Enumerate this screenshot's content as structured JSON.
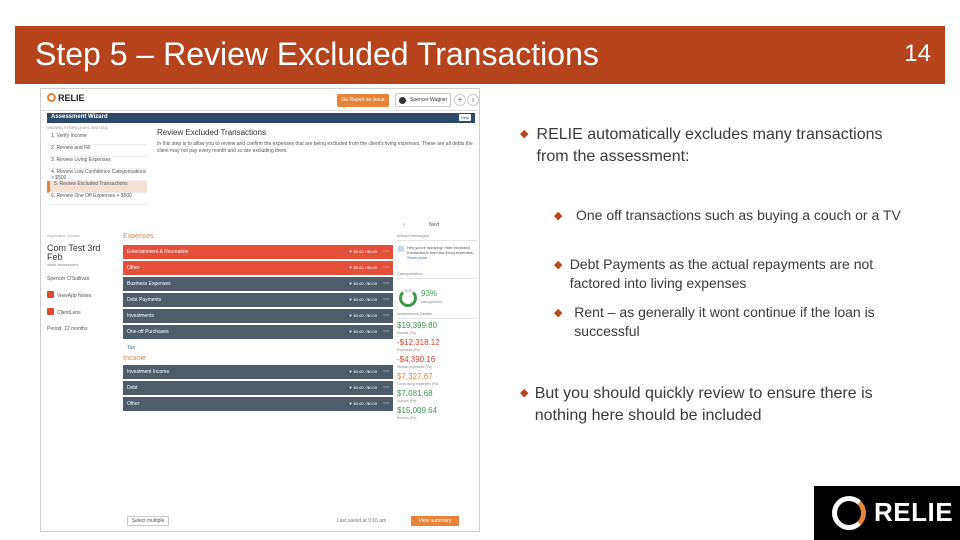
{
  "slide": {
    "title": "Step 5 – Review Excluded Transactions",
    "number": "14"
  },
  "bullets": {
    "b1": "RELIE automatically excludes many transactions from the assessment:",
    "sub1": "One off transactions such as buying  a couch or a TV",
    "sub2": "Debt Payments as the actual repayments are not factored into living expenses",
    "sub3": "Rent – as generally it wont continue if the loan is successful",
    "b2": "But you should quickly review to ensure there is nothing here should be included"
  },
  "logo": {
    "text": "RELIE"
  },
  "colors": {
    "accent": "#b5441c",
    "orange": "#e8833a",
    "navy": "#2d4a6b"
  },
  "screenshot": {
    "logo": "RELIE",
    "report_btn": "Go Report an issue",
    "user": "Spencer Wagner",
    "wizard_title": "Assessment Wizard",
    "help": "Help",
    "steps_header": "WIZARD STEPS (4 of 6 VISITED)",
    "steps": [
      "1. Verify Income",
      "2. Review and Fill",
      "3. Review Living Expenses",
      "4. Review Low Confidence Categorisations > $500",
      "5. Review Excluded Transactions",
      "6. Review One Off Expenses > $500"
    ],
    "review_title": "Review Excluded Transactions",
    "review_body": "In this step is to allow you to review and confirm the expenses that are being excluded from the client's living expenses. These are all debts the client may not pay every month and so are excluding them.",
    "nav_prev": "‹",
    "nav_next": "Next",
    "side_header": "Application Details",
    "client_name": "Com Test 3rd Feb",
    "client_sub": "initial assessment",
    "side_owner": "Spencer O'Sullivan",
    "side_line2": "ViewApp Notes",
    "side_line3": "ClientLens",
    "period_label": "Period",
    "period_value": "12 months",
    "expenses_header": "Expenses",
    "rows": [
      {
        "label": "Entertainment & Recreation",
        "amt": "▼ $0.00 / $0.00"
      },
      {
        "label": "Other",
        "amt": "▼ $0.00 / $0.00"
      },
      {
        "label": "Business Expenses",
        "amt": "▼ $0.00 / $0.00"
      },
      {
        "label": "Debt Payments",
        "amt": "▼ $0.00 / $0.00"
      },
      {
        "label": "Investments",
        "amt": "▼ $0.00 / $0.00"
      },
      {
        "label": "One-off Purchases",
        "amt": "▼ $0.00 / $0.00"
      },
      {
        "label": "Tax",
        "amt": ""
      },
      {
        "label": "Investment Income",
        "amt": "▼ $0.00 / $0.00"
      },
      {
        "label": "Debt",
        "amt": "▼ $0.00 / $0.00"
      },
      {
        "label": "Other",
        "amt": "▼ $0.00 / $0.00"
      }
    ],
    "income_header": "Income",
    "panel_header": "Wizard Messages",
    "panel_msg": "Hey you're applying! Hide excluded transactions from the living expenses.",
    "panel_link": "Show more",
    "comp_header": "Categorisation",
    "comp_pct": "93%",
    "comp_label": "categorised",
    "assess_header": "Assessment Details",
    "v1": "$19,399.80",
    "v2": "-$12,318.12",
    "v3": "-$4,390.16",
    "v4": "$7,327.67",
    "v5": "$7,081.68",
    "v6": "$15,009.64",
    "v1_lab": "Income (Pa)",
    "v2_lab": "Expenses (Pa)",
    "v3_lab": "Median expenses (Pa)",
    "v4_lab": "Client living expenses (Pa)",
    "v5_lab": "Surplus (Pa)",
    "v6_lab": "Surplus (Pa)",
    "select_btn": "Select multiple",
    "saved": "Last saved at 9:16 am",
    "view_btn": "View summary"
  }
}
